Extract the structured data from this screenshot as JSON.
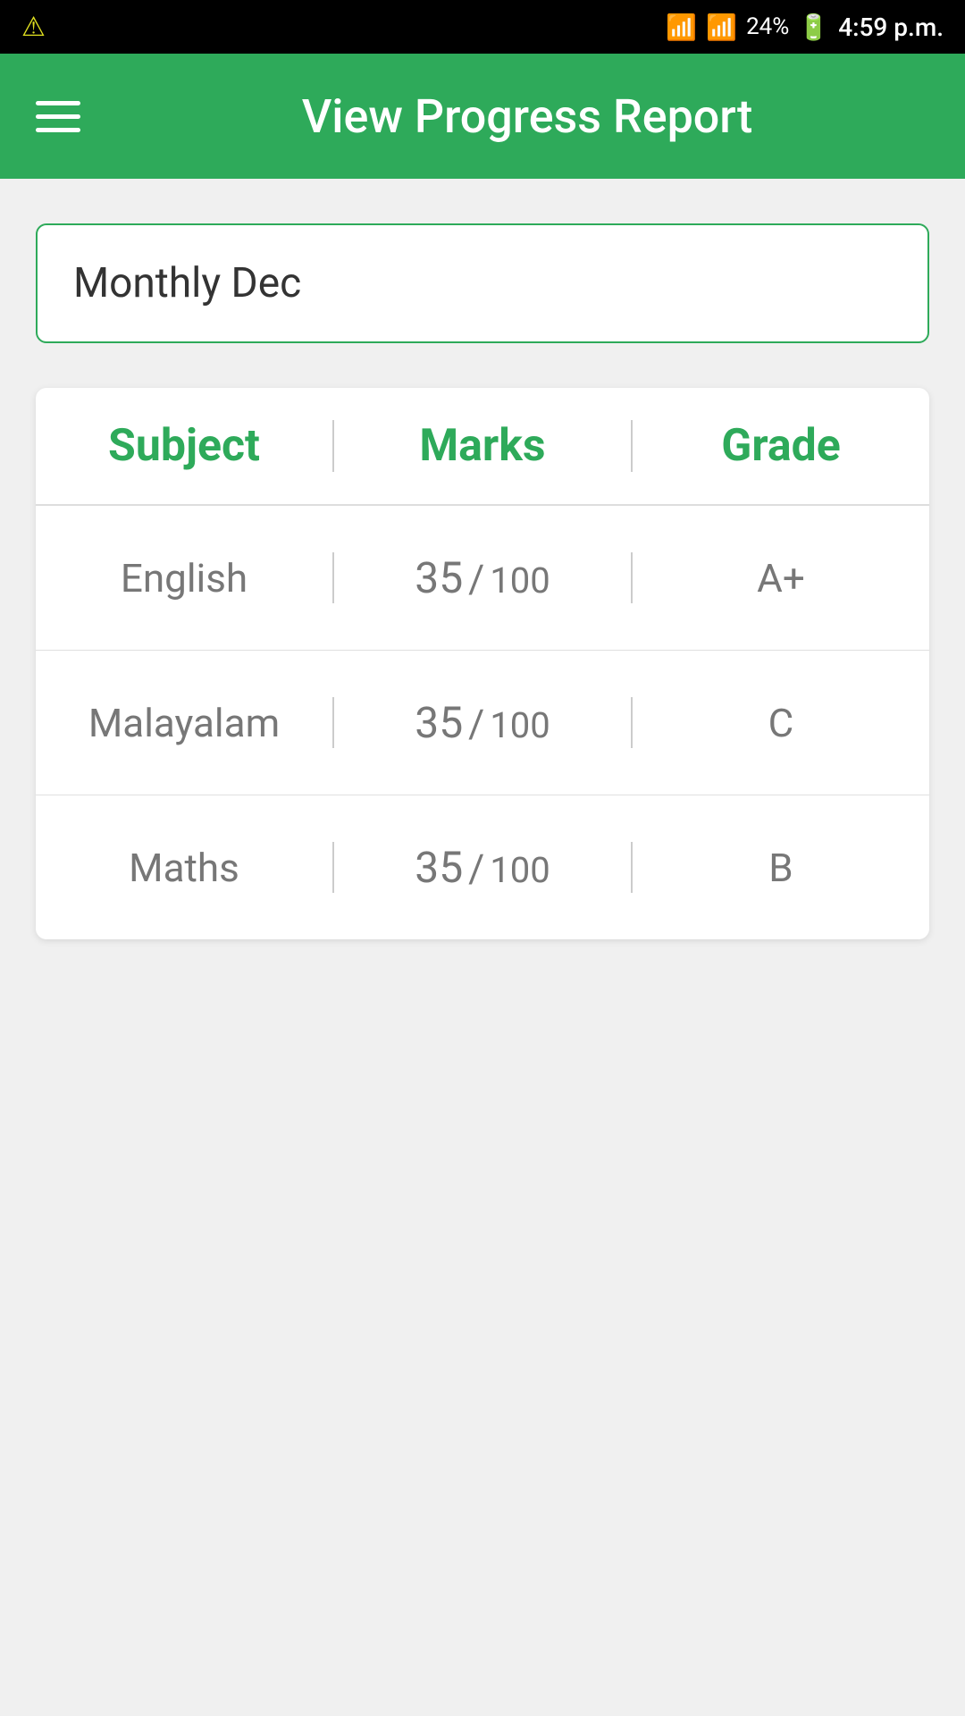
{
  "statusBar": {
    "time": "4:59 p.m.",
    "battery": "24%",
    "warningIcon": "⚠",
    "wifiIcon": "WiFi",
    "signalIcon": "Signal"
  },
  "appBar": {
    "title": "View Progress Report",
    "menuIcon": "menu"
  },
  "selector": {
    "value": "Monthly Dec"
  },
  "table": {
    "headers": {
      "subject": "Subject",
      "marks": "Marks",
      "grade": "Grade"
    },
    "rows": [
      {
        "subject": "English",
        "score": "35",
        "total": "100",
        "slash": "/",
        "grade": "A+"
      },
      {
        "subject": "Malayalam",
        "score": "35",
        "total": "100",
        "slash": "/",
        "grade": "C"
      },
      {
        "subject": "Maths",
        "score": "35",
        "total": "100",
        "slash": "/",
        "grade": "B"
      }
    ]
  }
}
